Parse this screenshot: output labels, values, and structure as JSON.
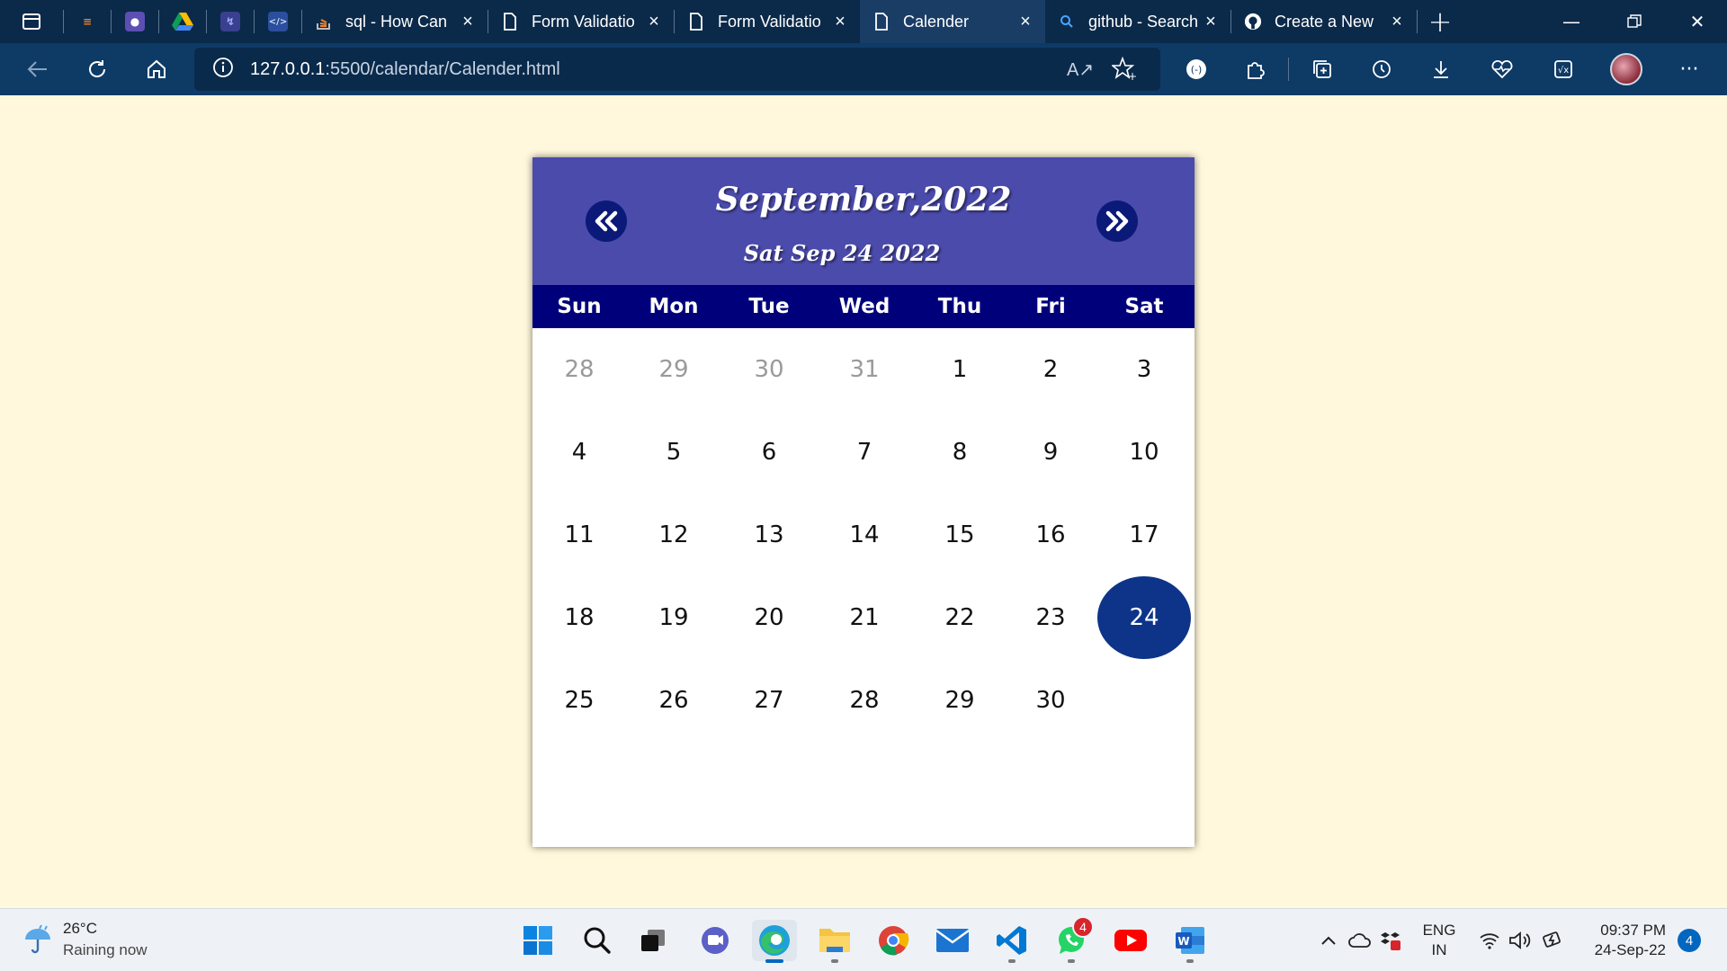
{
  "browser": {
    "tabs": [
      {
        "title": "sql - How Can",
        "icon": "stackoverflow-icon",
        "active": false
      },
      {
        "title": "Form Validatio",
        "icon": "document-icon",
        "active": false
      },
      {
        "title": "Form Validatio",
        "icon": "document-icon",
        "active": false
      },
      {
        "title": "Calender",
        "icon": "document-icon",
        "active": true
      },
      {
        "title": "github - Search",
        "icon": "search-icon",
        "active": false
      },
      {
        "title": "Create a New",
        "icon": "github-icon",
        "active": false
      }
    ],
    "address": {
      "host": "127.0.0.1",
      "path": ":5500/calendar/Calender.html"
    }
  },
  "calendar": {
    "month_year": "September,2022",
    "today_text": "Sat Sep 24 2022",
    "weekdays": [
      "Sun",
      "Mon",
      "Tue",
      "Wed",
      "Thu",
      "Fri",
      "Sat"
    ],
    "weeks": [
      [
        {
          "d": "28",
          "other": true
        },
        {
          "d": "29",
          "other": true
        },
        {
          "d": "30",
          "other": true
        },
        {
          "d": "31",
          "other": true
        },
        {
          "d": "1"
        },
        {
          "d": "2"
        },
        {
          "d": "3"
        }
      ],
      [
        {
          "d": "4"
        },
        {
          "d": "5"
        },
        {
          "d": "6"
        },
        {
          "d": "7"
        },
        {
          "d": "8"
        },
        {
          "d": "9"
        },
        {
          "d": "10"
        }
      ],
      [
        {
          "d": "11"
        },
        {
          "d": "12"
        },
        {
          "d": "13"
        },
        {
          "d": "14"
        },
        {
          "d": "15"
        },
        {
          "d": "16"
        },
        {
          "d": "17"
        }
      ],
      [
        {
          "d": "18"
        },
        {
          "d": "19"
        },
        {
          "d": "20"
        },
        {
          "d": "21"
        },
        {
          "d": "22"
        },
        {
          "d": "23"
        },
        {
          "d": "24",
          "today": true
        }
      ],
      [
        {
          "d": "25"
        },
        {
          "d": "26"
        },
        {
          "d": "27"
        },
        {
          "d": "28"
        },
        {
          "d": "29"
        },
        {
          "d": "30"
        }
      ]
    ],
    "colors": {
      "header_bg": "#4b4bac",
      "weekday_bg": "#00007a",
      "today_bg": "#0d3488",
      "page_bg": "#fff8dc"
    }
  },
  "taskbar": {
    "weather": {
      "temp": "26°C",
      "condition": "Raining now"
    },
    "whatsapp_badge": "4",
    "language": {
      "line1": "ENG",
      "line2": "IN"
    },
    "clock": {
      "time": "09:37 PM",
      "date": "24-Sep-22"
    },
    "notifications": "4"
  }
}
